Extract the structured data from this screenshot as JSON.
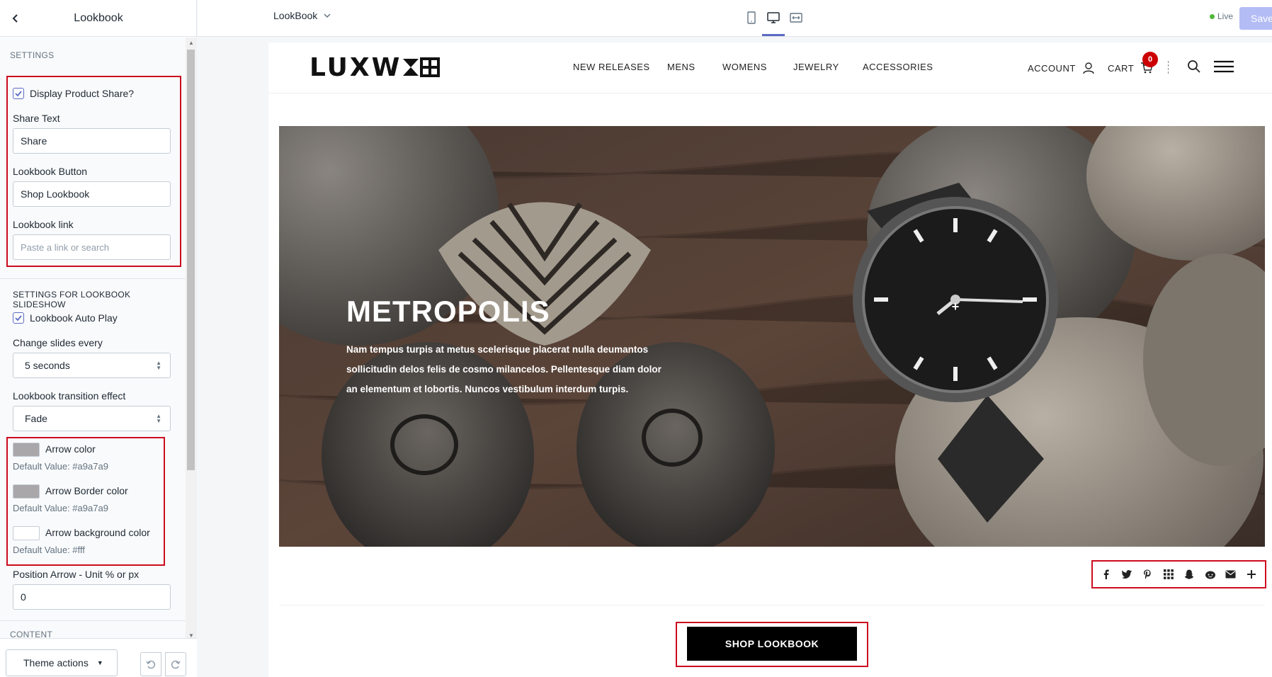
{
  "sidebar": {
    "title": "Lookbook",
    "settings_header": "SETTINGS",
    "display_share_label": "Display Product Share?",
    "share_text_label": "Share Text",
    "share_text_value": "Share",
    "lookbook_button_label": "Lookbook Button",
    "lookbook_button_value": "Shop Lookbook",
    "lookbook_link_label": "Lookbook link",
    "lookbook_link_placeholder": "Paste a link or search",
    "slideshow_header": "SETTINGS FOR LOOKBOOK SLIDESHOW",
    "autoplay_label": "Lookbook Auto Play",
    "change_slides_label": "Change slides every",
    "change_slides_value": "5 seconds",
    "transition_label": "Lookbook transition effect",
    "transition_value": "Fade",
    "arrow_color_label": "Arrow color",
    "arrow_color_default": "Default Value: #a9a7a9",
    "arrow_border_label": "Arrow Border color",
    "arrow_border_default": "Default Value: #a9a7a9",
    "arrow_bg_label": "Arrow background color",
    "arrow_bg_default": "Default Value: #fff",
    "position_arrow_label": "Position Arrow - Unit % or px",
    "position_arrow_value": "0",
    "content_header": "CONTENT",
    "theme_actions": "Theme actions",
    "colors": {
      "arrow_color": "#a9a7a9",
      "arrow_border": "#a9a7a9",
      "arrow_bg": "#ffffff"
    }
  },
  "topbar": {
    "page_selector": "LookBook",
    "live_label": "Live",
    "save_label": "Save"
  },
  "site": {
    "logo": "LUXW",
    "nav": [
      "NEW RELEASES",
      "MENS",
      "WOMENS",
      "JEWELRY",
      "ACCESSORIES"
    ],
    "account_label": "ACCOUNT",
    "cart_label": "CART",
    "cart_count": "0",
    "hero_title": "METROPOLIS",
    "hero_text": "Nam tempus turpis at metus scelerisque placerat nulla deumantos sollicitudin delos felis de cosmo milancelos. Pellentesque diam dolor an elementum et lobortis. Nuncos vestibulum interdum turpis.",
    "shop_button": "SHOP LOOKBOOK",
    "share_icons": [
      "facebook-icon",
      "twitter-icon",
      "pinterest-icon",
      "grid-icon",
      "snapchat-icon",
      "reddit-icon",
      "email-icon",
      "plus-icon"
    ],
    "hotspot_symbol": "+",
    "accent_red": "#cc0c1f"
  }
}
